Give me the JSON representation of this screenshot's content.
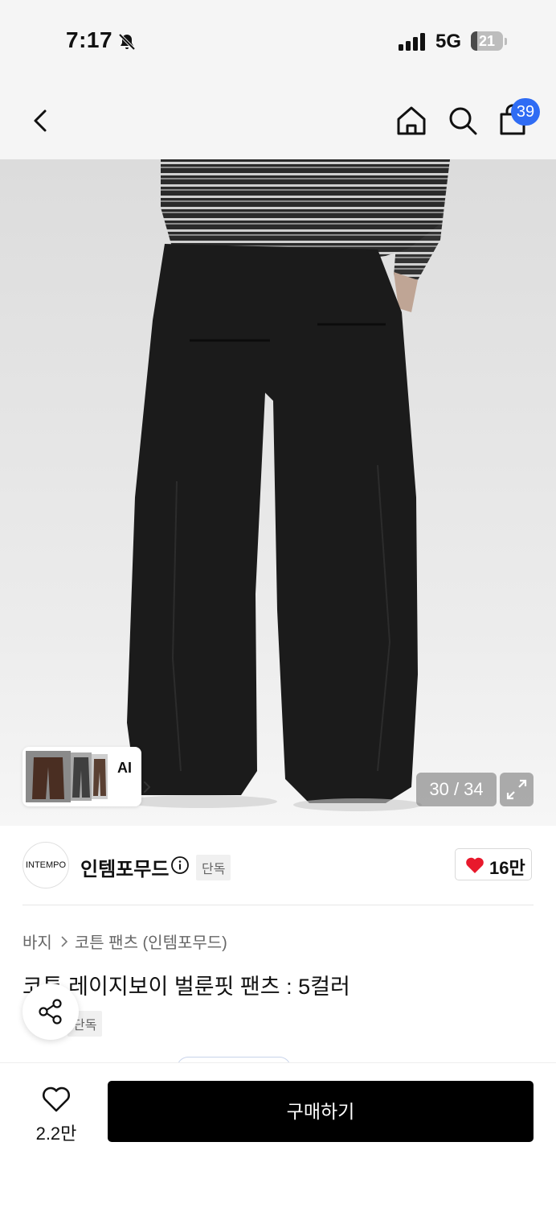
{
  "status_bar": {
    "time": "7:17",
    "network": "5G",
    "battery": "21",
    "battery_level": 0.21
  },
  "nav": {
    "cart_count": "39"
  },
  "gallery": {
    "ai_label": "AI",
    "counter": "30 / 34",
    "current": 30,
    "total": 34
  },
  "brand": {
    "logo_text": "INTEMPO",
    "name": "인템포무드",
    "tag": "단독",
    "likes": "16만"
  },
  "product": {
    "breadcrumb": [
      "바지",
      "코튼 팬츠 (인템포무드)"
    ],
    "title": "코튼 레이지보이 벌룬핏 팬츠 : 5컬러",
    "tag": "단독"
  },
  "bottom": {
    "wish_count": "2.2만",
    "buy_label": "구매하기"
  },
  "icons": [
    "bell-slash-icon",
    "signal-icon",
    "back-icon",
    "home-icon",
    "search-icon",
    "shopping-bag-icon",
    "chevron-right-icon",
    "expand-icon",
    "info-icon",
    "heart-icon",
    "share-icon"
  ],
  "colors": {
    "badge": "#2f6cf4",
    "like": "#e8192c",
    "buy_button": "#000000"
  }
}
